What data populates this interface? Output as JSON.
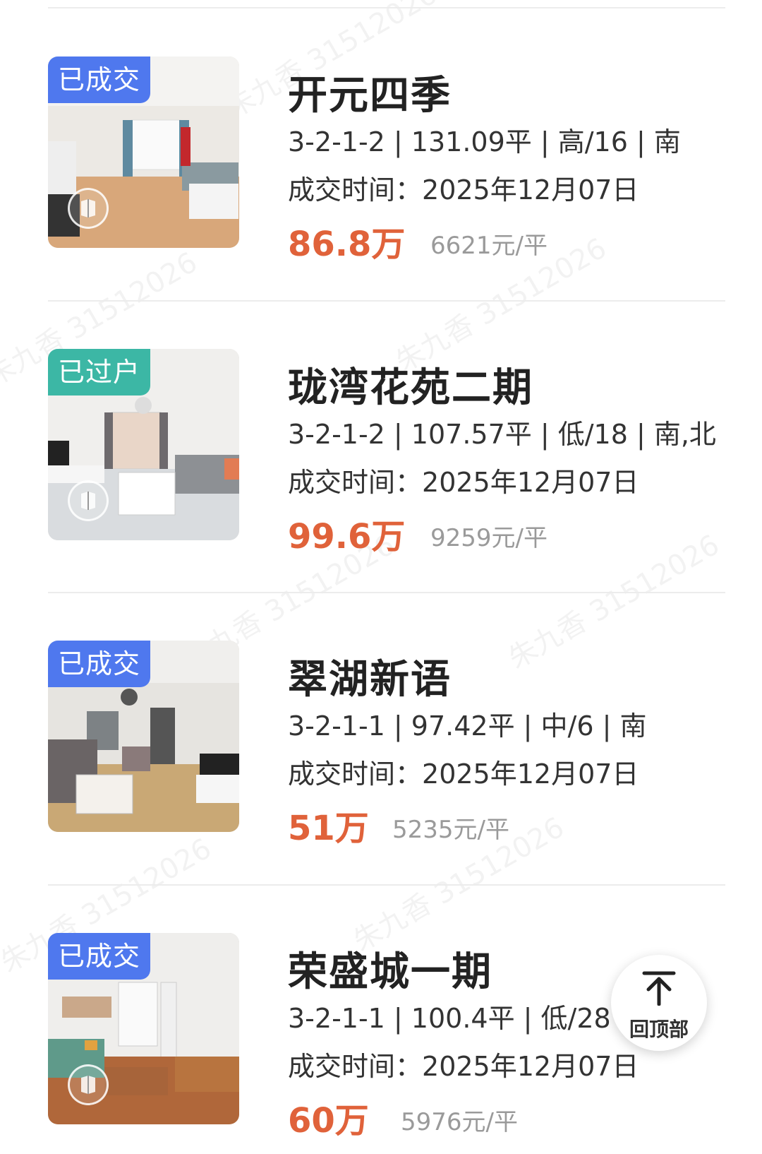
{
  "listings": [
    {
      "status": "已成交",
      "status_color": "#4f78ee",
      "name": "开元四季",
      "specs": "3-2-1-2 | 131.09平 | 高/16 | 南",
      "deal_label": "成交时间：",
      "deal_date": "2025年12月07日",
      "price": "86.8万",
      "unit_price": "6621元/平"
    },
    {
      "status": "已过户",
      "status_color": "#3cb7a5",
      "name": "珑湾花苑二期",
      "specs": "3-2-1-2 | 107.57平 | 低/18 | 南,北",
      "deal_label": "成交时间：",
      "deal_date": "2025年12月07日",
      "price": "99.6万",
      "unit_price": "9259元/平"
    },
    {
      "status": "已成交",
      "status_color": "#4f78ee",
      "name": "翠湖新语",
      "specs": "3-2-1-1 | 97.42平 | 中/6 | 南",
      "deal_label": "成交时间：",
      "deal_date": "2025年12月07日",
      "price": "51万",
      "unit_price": "5235元/平"
    },
    {
      "status": "已成交",
      "status_color": "#4f78ee",
      "name": "荣盛城一期",
      "specs": "3-2-1-1 | 100.4平 | 低/28 |",
      "deal_label": "成交时间：",
      "deal_date": "2025年12月07日",
      "price": "60万",
      "unit_price": "5976元/平"
    }
  ],
  "back_to_top": {
    "label": "回顶部",
    "icon": "arrow-up-icon"
  },
  "watermark": "朱九香 31512026",
  "colors": {
    "price": "#e0623a",
    "badge_blue": "#4f78ee",
    "badge_green": "#3cb7a5"
  }
}
